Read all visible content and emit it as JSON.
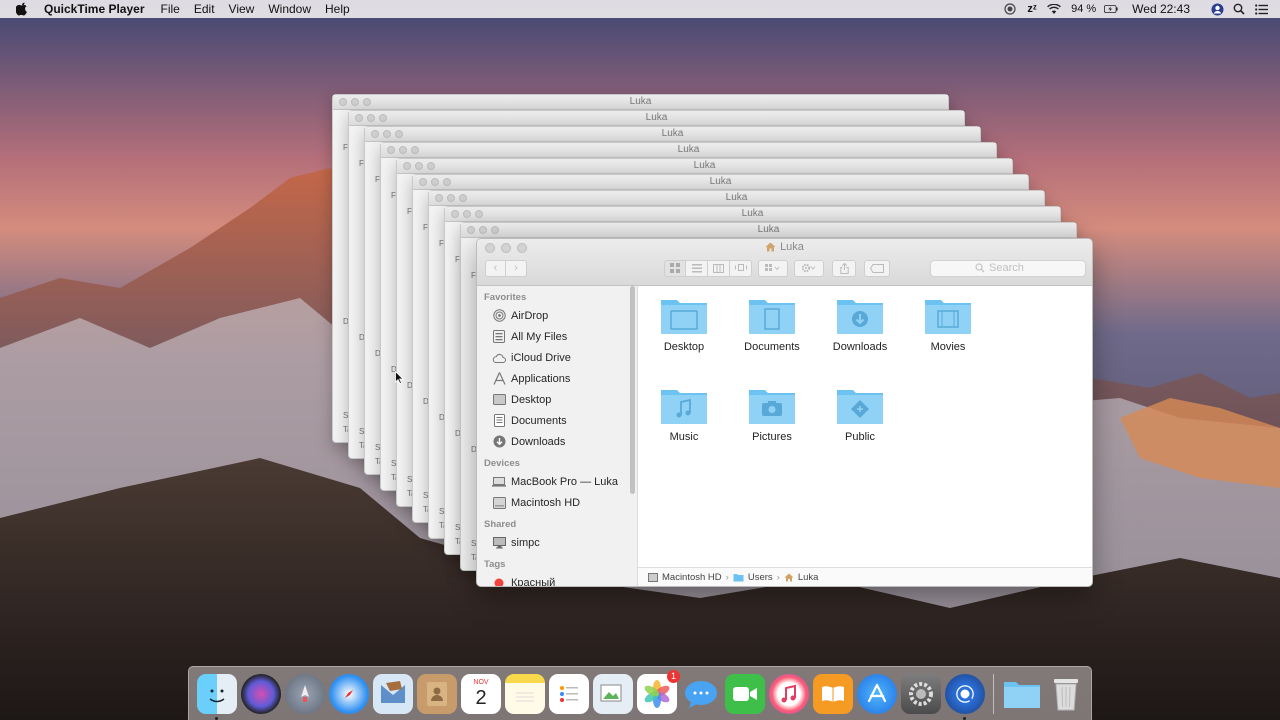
{
  "menubar": {
    "app_name": "QuickTime Player",
    "menus": [
      "File",
      "Edit",
      "View",
      "Window",
      "Help"
    ],
    "battery": "94 %",
    "clock": "Wed 22:43"
  },
  "finder": {
    "title": "Luka",
    "search_placeholder": "Search",
    "sidebar": {
      "favorites_label": "Favorites",
      "favorites": [
        {
          "label": "AirDrop",
          "icon": "airdrop-icon"
        },
        {
          "label": "All My Files",
          "icon": "all-files-icon"
        },
        {
          "label": "iCloud Drive",
          "icon": "cloud-icon"
        },
        {
          "label": "Applications",
          "icon": "applications-icon"
        },
        {
          "label": "Desktop",
          "icon": "desktop-icon"
        },
        {
          "label": "Documents",
          "icon": "documents-icon"
        },
        {
          "label": "Downloads",
          "icon": "downloads-icon"
        }
      ],
      "devices_label": "Devices",
      "devices": [
        {
          "label": "MacBook Pro — Luka",
          "icon": "laptop-icon"
        },
        {
          "label": "Macintosh HD",
          "icon": "hard-drive-icon"
        }
      ],
      "shared_label": "Shared",
      "shared": [
        {
          "label": "simpc",
          "icon": "pc-icon"
        }
      ],
      "tags_label": "Tags",
      "tags": [
        {
          "label": "Красный",
          "color": "#f2433a"
        }
      ]
    },
    "folders": [
      "Desktop",
      "Documents",
      "Downloads",
      "Movies",
      "Music",
      "Pictures",
      "Public"
    ],
    "path": [
      "Macintosh HD",
      "Users",
      "Luka"
    ]
  },
  "stack": {
    "title": "Luka",
    "labels": [
      "Fa",
      "De",
      "Sh",
      "Ta"
    ]
  },
  "dock": {
    "calendar_month": "NOV",
    "calendar_day": "2",
    "photos_badge": "1"
  },
  "colors": {
    "folder_blue": "#6cc3f1",
    "accent": "#3a86ff"
  }
}
